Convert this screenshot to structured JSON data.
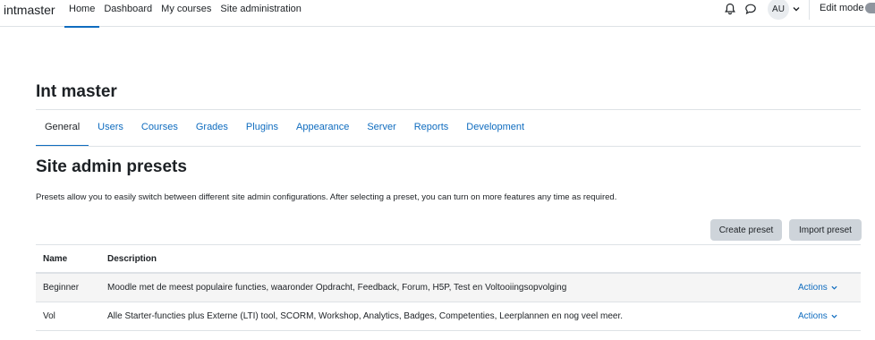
{
  "navbar": {
    "brand": "intmaster",
    "links": [
      "Home",
      "Dashboard",
      "My courses",
      "Site administration"
    ],
    "active_link": "Home",
    "avatar_initials": "AU",
    "edit_mode_label": "Edit mode",
    "icons": [
      "bell-icon",
      "chat-icon",
      "chevron-down-icon"
    ]
  },
  "page": {
    "header": "Int master",
    "tabs": [
      "General",
      "Users",
      "Courses",
      "Grades",
      "Plugins",
      "Appearance",
      "Server",
      "Reports",
      "Development"
    ],
    "active_tab": "General",
    "heading": "Site admin presets",
    "intro": "Presets allow you to easily switch between different site admin configurations. After selecting a preset, you can turn on more features any time as required."
  },
  "buttons": {
    "create": "Create preset",
    "import": "Import preset"
  },
  "table": {
    "headers": [
      "Name",
      "Description"
    ],
    "rows": [
      {
        "name": "Beginner",
        "description": "Moodle met de meest populaire functies, waaronder Opdracht, Feedback, Forum, H5P, Test en Voltooiingsopvolging",
        "actions": "Actions"
      },
      {
        "name": "Vol",
        "description": "Alle Starter-functies plus Externe (LTI) tool, SCORM, Workshop, Analytics, Badges, Competenties, Leerplannen en nog veel meer.",
        "actions": "Actions"
      }
    ]
  },
  "colors": {
    "link": "#0f6cbf",
    "text": "#1d2125",
    "button_bg": "#ced4da",
    "border": "#dee2e6",
    "stripe": "#f5f5f5"
  }
}
